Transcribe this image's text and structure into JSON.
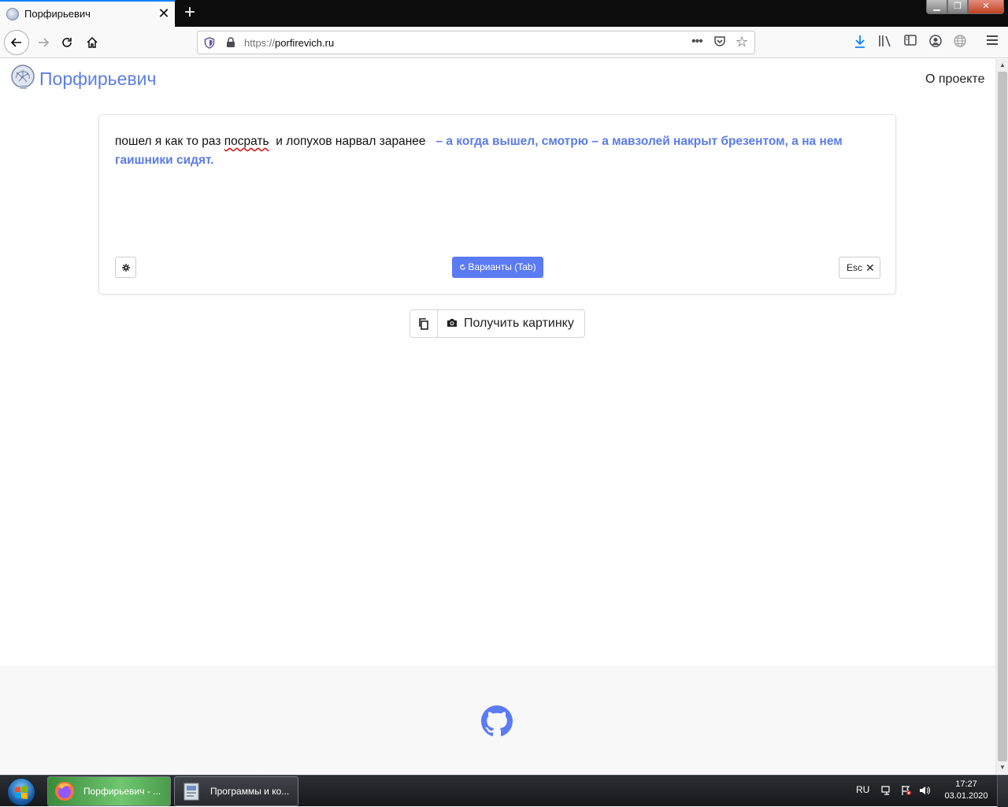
{
  "browser": {
    "tab": {
      "title": "Порфирьевич",
      "close_label": "✕"
    },
    "new_tab_label": "+",
    "window_controls": {
      "minimize": "▁",
      "maximize": "❐",
      "close": "✕"
    },
    "url": {
      "scheme": "https://",
      "host": "porfirevich.ru"
    },
    "icons": [
      "back-icon",
      "forward-icon",
      "reload-icon",
      "home-icon",
      "shield-icon",
      "lock-icon",
      "page-actions-icon",
      "pocket-icon",
      "bookmark-star-icon",
      "download-icon",
      "library-icon",
      "sidebar-icon",
      "account-icon",
      "globe-icon",
      "menu-icon"
    ]
  },
  "page": {
    "brand": "Порфирьевич",
    "nav_about": "О проекте",
    "editor": {
      "text_before": "пошел я как то раз ",
      "text_misspelled": "посрать",
      "text_after": "  и лопухов нарвал заранее  ",
      "generated": " – а когда вышел, смотрю – а мавзолей накрыт брезентом, а на нем гаишники сидят."
    },
    "buttons": {
      "variants": "Варианты (Tab)",
      "esc": "Esc",
      "get_picture": "Получить картинку"
    },
    "accent_color": "#5b7bf5",
    "brand_color": "#5d7ee5"
  },
  "taskbar": {
    "items": [
      {
        "label": "Порфирьевич - ...",
        "icon": "firefox-icon",
        "active": true
      },
      {
        "label": "Программы и ко...",
        "icon": "control-panel-icon",
        "active": false
      }
    ],
    "language": "RU",
    "time": "17:27",
    "date": "03.01.2020"
  }
}
